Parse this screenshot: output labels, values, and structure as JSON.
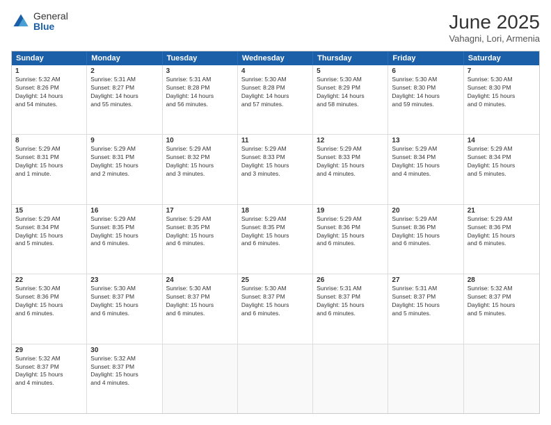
{
  "logo": {
    "general": "General",
    "blue": "Blue"
  },
  "title": "June 2025",
  "subtitle": "Vahagni, Lori, Armenia",
  "days": [
    "Sunday",
    "Monday",
    "Tuesday",
    "Wednesday",
    "Thursday",
    "Friday",
    "Saturday"
  ],
  "rows": [
    [
      {
        "day": "1",
        "lines": [
          "Sunrise: 5:32 AM",
          "Sunset: 8:26 PM",
          "Daylight: 14 hours",
          "and 54 minutes."
        ]
      },
      {
        "day": "2",
        "lines": [
          "Sunrise: 5:31 AM",
          "Sunset: 8:27 PM",
          "Daylight: 14 hours",
          "and 55 minutes."
        ]
      },
      {
        "day": "3",
        "lines": [
          "Sunrise: 5:31 AM",
          "Sunset: 8:28 PM",
          "Daylight: 14 hours",
          "and 56 minutes."
        ]
      },
      {
        "day": "4",
        "lines": [
          "Sunrise: 5:30 AM",
          "Sunset: 8:28 PM",
          "Daylight: 14 hours",
          "and 57 minutes."
        ]
      },
      {
        "day": "5",
        "lines": [
          "Sunrise: 5:30 AM",
          "Sunset: 8:29 PM",
          "Daylight: 14 hours",
          "and 58 minutes."
        ]
      },
      {
        "day": "6",
        "lines": [
          "Sunrise: 5:30 AM",
          "Sunset: 8:30 PM",
          "Daylight: 14 hours",
          "and 59 minutes."
        ]
      },
      {
        "day": "7",
        "lines": [
          "Sunrise: 5:30 AM",
          "Sunset: 8:30 PM",
          "Daylight: 15 hours",
          "and 0 minutes."
        ]
      }
    ],
    [
      {
        "day": "8",
        "lines": [
          "Sunrise: 5:29 AM",
          "Sunset: 8:31 PM",
          "Daylight: 15 hours",
          "and 1 minute."
        ]
      },
      {
        "day": "9",
        "lines": [
          "Sunrise: 5:29 AM",
          "Sunset: 8:31 PM",
          "Daylight: 15 hours",
          "and 2 minutes."
        ]
      },
      {
        "day": "10",
        "lines": [
          "Sunrise: 5:29 AM",
          "Sunset: 8:32 PM",
          "Daylight: 15 hours",
          "and 3 minutes."
        ]
      },
      {
        "day": "11",
        "lines": [
          "Sunrise: 5:29 AM",
          "Sunset: 8:33 PM",
          "Daylight: 15 hours",
          "and 3 minutes."
        ]
      },
      {
        "day": "12",
        "lines": [
          "Sunrise: 5:29 AM",
          "Sunset: 8:33 PM",
          "Daylight: 15 hours",
          "and 4 minutes."
        ]
      },
      {
        "day": "13",
        "lines": [
          "Sunrise: 5:29 AM",
          "Sunset: 8:34 PM",
          "Daylight: 15 hours",
          "and 4 minutes."
        ]
      },
      {
        "day": "14",
        "lines": [
          "Sunrise: 5:29 AM",
          "Sunset: 8:34 PM",
          "Daylight: 15 hours",
          "and 5 minutes."
        ]
      }
    ],
    [
      {
        "day": "15",
        "lines": [
          "Sunrise: 5:29 AM",
          "Sunset: 8:34 PM",
          "Daylight: 15 hours",
          "and 5 minutes."
        ]
      },
      {
        "day": "16",
        "lines": [
          "Sunrise: 5:29 AM",
          "Sunset: 8:35 PM",
          "Daylight: 15 hours",
          "and 6 minutes."
        ]
      },
      {
        "day": "17",
        "lines": [
          "Sunrise: 5:29 AM",
          "Sunset: 8:35 PM",
          "Daylight: 15 hours",
          "and 6 minutes."
        ]
      },
      {
        "day": "18",
        "lines": [
          "Sunrise: 5:29 AM",
          "Sunset: 8:35 PM",
          "Daylight: 15 hours",
          "and 6 minutes."
        ]
      },
      {
        "day": "19",
        "lines": [
          "Sunrise: 5:29 AM",
          "Sunset: 8:36 PM",
          "Daylight: 15 hours",
          "and 6 minutes."
        ]
      },
      {
        "day": "20",
        "lines": [
          "Sunrise: 5:29 AM",
          "Sunset: 8:36 PM",
          "Daylight: 15 hours",
          "and 6 minutes."
        ]
      },
      {
        "day": "21",
        "lines": [
          "Sunrise: 5:29 AM",
          "Sunset: 8:36 PM",
          "Daylight: 15 hours",
          "and 6 minutes."
        ]
      }
    ],
    [
      {
        "day": "22",
        "lines": [
          "Sunrise: 5:30 AM",
          "Sunset: 8:36 PM",
          "Daylight: 15 hours",
          "and 6 minutes."
        ]
      },
      {
        "day": "23",
        "lines": [
          "Sunrise: 5:30 AM",
          "Sunset: 8:37 PM",
          "Daylight: 15 hours",
          "and 6 minutes."
        ]
      },
      {
        "day": "24",
        "lines": [
          "Sunrise: 5:30 AM",
          "Sunset: 8:37 PM",
          "Daylight: 15 hours",
          "and 6 minutes."
        ]
      },
      {
        "day": "25",
        "lines": [
          "Sunrise: 5:30 AM",
          "Sunset: 8:37 PM",
          "Daylight: 15 hours",
          "and 6 minutes."
        ]
      },
      {
        "day": "26",
        "lines": [
          "Sunrise: 5:31 AM",
          "Sunset: 8:37 PM",
          "Daylight: 15 hours",
          "and 6 minutes."
        ]
      },
      {
        "day": "27",
        "lines": [
          "Sunrise: 5:31 AM",
          "Sunset: 8:37 PM",
          "Daylight: 15 hours",
          "and 5 minutes."
        ]
      },
      {
        "day": "28",
        "lines": [
          "Sunrise: 5:32 AM",
          "Sunset: 8:37 PM",
          "Daylight: 15 hours",
          "and 5 minutes."
        ]
      }
    ],
    [
      {
        "day": "29",
        "lines": [
          "Sunrise: 5:32 AM",
          "Sunset: 8:37 PM",
          "Daylight: 15 hours",
          "and 4 minutes."
        ]
      },
      {
        "day": "30",
        "lines": [
          "Sunrise: 5:32 AM",
          "Sunset: 8:37 PM",
          "Daylight: 15 hours",
          "and 4 minutes."
        ]
      },
      {
        "day": "",
        "lines": [],
        "empty": true
      },
      {
        "day": "",
        "lines": [],
        "empty": true
      },
      {
        "day": "",
        "lines": [],
        "empty": true
      },
      {
        "day": "",
        "lines": [],
        "empty": true
      },
      {
        "day": "",
        "lines": [],
        "empty": true
      }
    ]
  ]
}
